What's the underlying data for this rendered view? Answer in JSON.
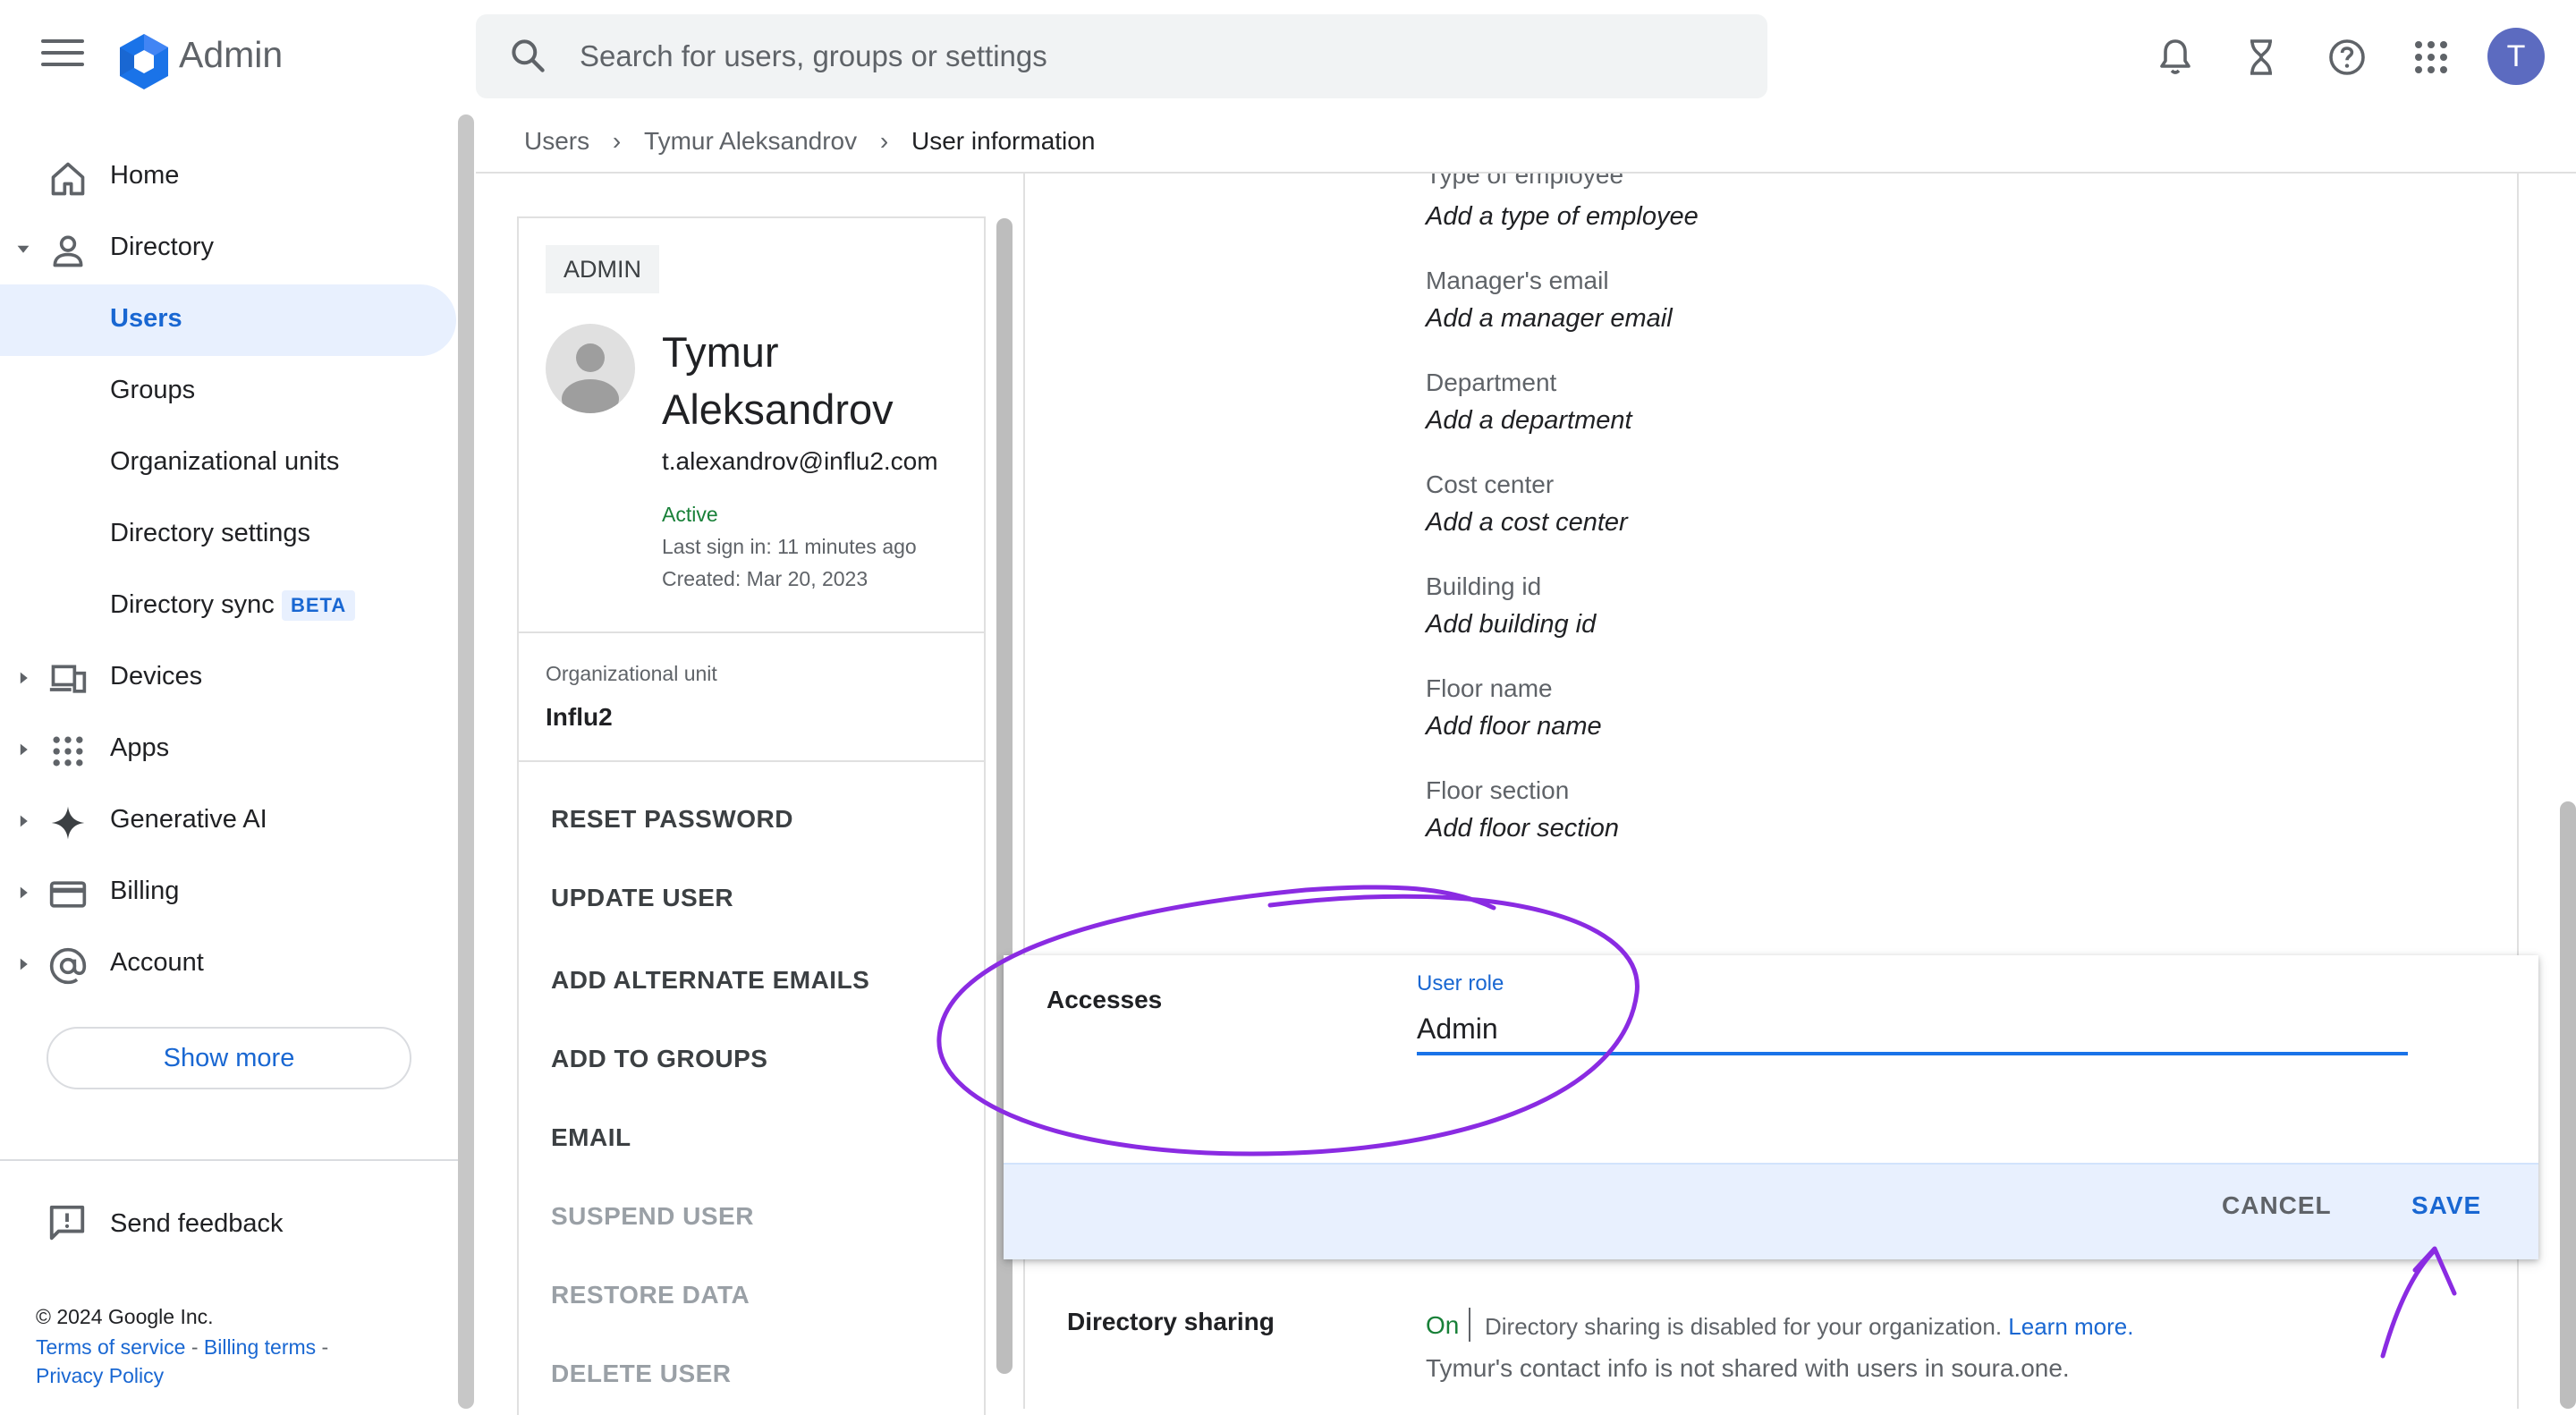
{
  "app": {
    "title": "Admin",
    "avatar_letter": "T"
  },
  "search": {
    "placeholder": "Search for users, groups or settings"
  },
  "topbar_icons": [
    "notifications-icon",
    "hourglass-icon",
    "help-icon",
    "apps-grid-icon"
  ],
  "nav": {
    "items": [
      {
        "label": "Home",
        "icon": "home-icon"
      },
      {
        "label": "Directory",
        "icon": "person-icon",
        "expanded": true
      },
      {
        "label": "Users",
        "selected": true
      },
      {
        "label": "Groups"
      },
      {
        "label": "Organizational units"
      },
      {
        "label": "Directory settings"
      },
      {
        "label": "Directory sync",
        "badge": "BETA"
      },
      {
        "label": "Devices",
        "icon": "devices-icon"
      },
      {
        "label": "Apps",
        "icon": "apps-icon"
      },
      {
        "label": "Generative AI",
        "icon": "sparkle-icon"
      },
      {
        "label": "Billing",
        "icon": "credit-card-icon"
      },
      {
        "label": "Account",
        "icon": "at-sign-icon"
      }
    ],
    "show_more": "Show more",
    "send_feedback": "Send feedback",
    "footer": {
      "copyright": "© 2024 Google Inc.",
      "terms": "Terms of service",
      "billing_terms": "Billing terms",
      "privacy": "Privacy Policy",
      "sep": " - "
    }
  },
  "breadcrumb": {
    "items": [
      "Users",
      "Tymur Aleksandrov",
      "User information"
    ],
    "separator": "›"
  },
  "user_card": {
    "role_badge": "ADMIN",
    "name": "Tymur Aleksandrov",
    "email": "t.alexandrov@influ2.com",
    "status": "Active",
    "last_sign_in": "Last sign in: 11 minutes ago",
    "created": "Created: Mar 20, 2023",
    "org_unit_label": "Organizational unit",
    "org_unit_value": "Influ2",
    "actions": [
      {
        "label": "RESET PASSWORD",
        "enabled": true
      },
      {
        "label": "UPDATE USER",
        "enabled": true
      },
      {
        "label": "ADD ALTERNATE EMAILS",
        "enabled": true
      },
      {
        "label": "ADD TO GROUPS",
        "enabled": true
      },
      {
        "label": "EMAIL",
        "enabled": true
      },
      {
        "label": "SUSPEND USER",
        "enabled": false
      },
      {
        "label": "RESTORE DATA",
        "enabled": false
      },
      {
        "label": "DELETE USER",
        "enabled": false
      }
    ]
  },
  "details": {
    "fields": [
      {
        "label": "Type of employee",
        "value": "Add a type of employee"
      },
      {
        "label": "Manager's email",
        "value": "Add a manager email"
      },
      {
        "label": "Department",
        "value": "Add a department"
      },
      {
        "label": "Cost center",
        "value": "Add a cost center"
      },
      {
        "label": "Building id",
        "value": "Add building id"
      },
      {
        "label": "Floor name",
        "value": "Add floor name"
      },
      {
        "label": "Floor section",
        "value": "Add floor section"
      }
    ]
  },
  "accesses": {
    "title": "Accesses",
    "role_label": "User role",
    "role_value": "Admin",
    "cancel": "CANCEL",
    "save": "SAVE"
  },
  "directory_sharing": {
    "label": "Directory sharing",
    "status": "On",
    "text": "Directory sharing is disabled for your organization.",
    "learn_more": "Learn more.",
    "note": "Tymur's contact info is not shared with users in soura.one."
  },
  "colors": {
    "accent": "#1967d2",
    "active": "#188038",
    "annotation": "#8a2be2"
  }
}
